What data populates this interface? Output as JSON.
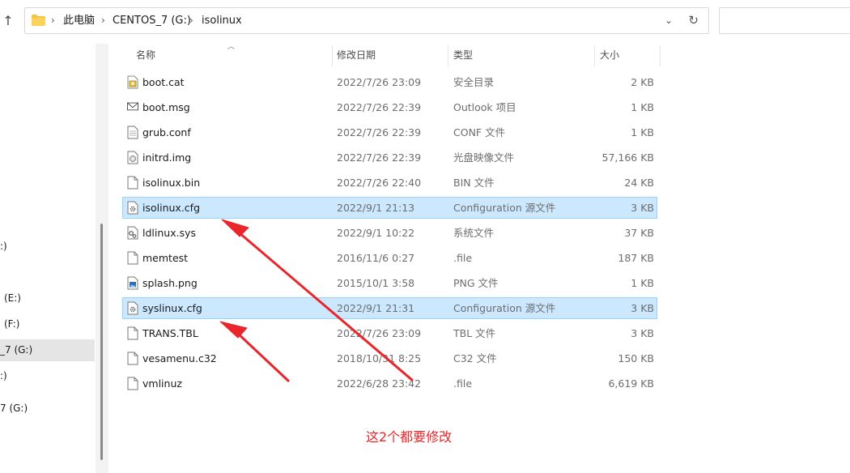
{
  "address_bar": {
    "crumbs": [
      "此电脑",
      "CENTOS_7 (G:)",
      "isolinux"
    ]
  },
  "nav_pane": {
    "items": [
      {
        "label": ":)",
        "selected": false
      },
      {
        "label": "(E:)",
        "selected": false
      },
      {
        "label": "(F:)",
        "selected": false
      },
      {
        "label": "_7 (G:)",
        "selected": true
      },
      {
        "label": ":)",
        "selected": false
      },
      {
        "label": "7 (G:)",
        "selected": false
      }
    ]
  },
  "columns": {
    "name": "名称",
    "date": "修改日期",
    "type": "类型",
    "size": "大小"
  },
  "files": [
    {
      "name": "boot.cat",
      "date": "2022/7/26 23:09",
      "type": "安全目录",
      "size": "2 KB",
      "icon": "security-catalog-icon",
      "selected": false
    },
    {
      "name": "boot.msg",
      "date": "2022/7/26 22:39",
      "type": "Outlook 项目",
      "size": "1 KB",
      "icon": "mail-icon",
      "selected": false
    },
    {
      "name": "grub.conf",
      "date": "2022/7/26 22:39",
      "type": "CONF 文件",
      "size": "1 KB",
      "icon": "text-file-icon",
      "selected": false
    },
    {
      "name": "initrd.img",
      "date": "2022/7/26 22:39",
      "type": "光盘映像文件",
      "size": "57,166 KB",
      "icon": "disc-image-icon",
      "selected": false
    },
    {
      "name": "isolinux.bin",
      "date": "2022/7/26 22:40",
      "type": "BIN 文件",
      "size": "24 KB",
      "icon": "blank-file-icon",
      "selected": false
    },
    {
      "name": "isolinux.cfg",
      "date": "2022/9/1 21:13",
      "type": "Configuration 源文件",
      "size": "3 KB",
      "icon": "config-file-icon",
      "selected": true
    },
    {
      "name": "ldlinux.sys",
      "date": "2022/9/1 10:22",
      "type": "系统文件",
      "size": "37 KB",
      "icon": "system-file-icon",
      "selected": false
    },
    {
      "name": "memtest",
      "date": "2016/11/6 0:27",
      "type": ".file",
      "size": "187 KB",
      "icon": "blank-file-icon",
      "selected": false
    },
    {
      "name": "splash.png",
      "date": "2015/10/1 3:58",
      "type": "PNG 文件",
      "size": "1 KB",
      "icon": "image-file-icon",
      "selected": false
    },
    {
      "name": "syslinux.cfg",
      "date": "2022/9/1 21:31",
      "type": "Configuration 源文件",
      "size": "3 KB",
      "icon": "config-file-icon",
      "selected": true
    },
    {
      "name": "TRANS.TBL",
      "date": "2022/7/26 23:09",
      "type": "TBL 文件",
      "size": "3 KB",
      "icon": "blank-file-icon",
      "selected": false
    },
    {
      "name": "vesamenu.c32",
      "date": "2018/10/31 8:25",
      "type": "C32 文件",
      "size": "150 KB",
      "icon": "blank-file-icon",
      "selected": false
    },
    {
      "name": "vmlinuz",
      "date": "2022/6/28 23:42",
      "type": ".file",
      "size": "6,619 KB",
      "icon": "blank-file-icon",
      "selected": false
    }
  ],
  "annotation": {
    "text": "这2个都要修改",
    "color": "#e8262b"
  },
  "colors": {
    "selection": "#cce8ff",
    "selection_border": "#99d1ff",
    "folder": "#f5c242"
  }
}
